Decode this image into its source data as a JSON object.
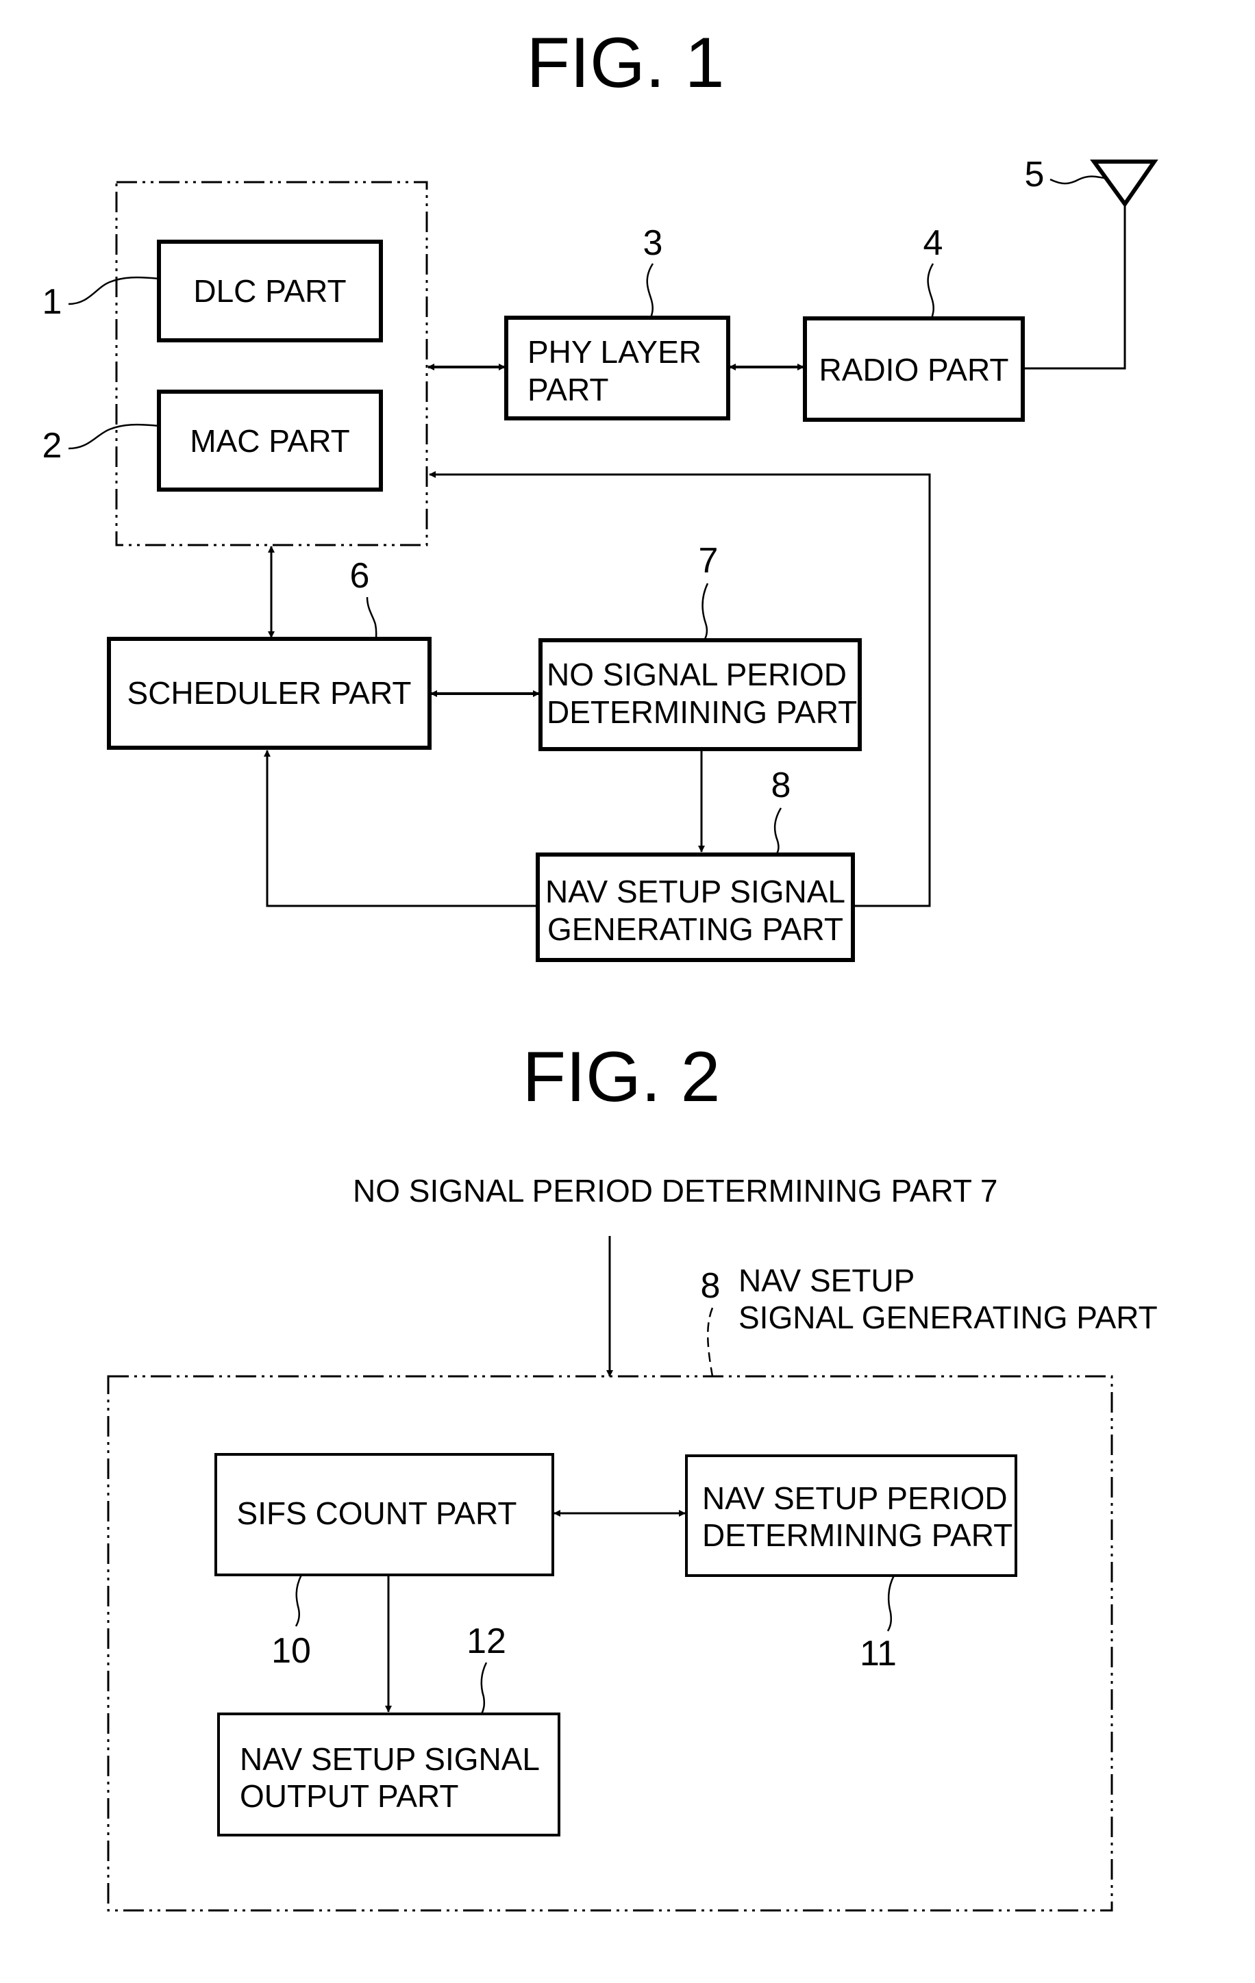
{
  "fig1": {
    "title": "FIG. 1",
    "blocks": {
      "dlc": {
        "label": "DLC PART",
        "ref": "1"
      },
      "mac": {
        "label": "MAC PART",
        "ref": "2"
      },
      "phy": {
        "label_line1": "PHY LAYER",
        "label_line2": "PART",
        "ref": "3"
      },
      "radio": {
        "label": "RADIO PART",
        "ref": "4"
      },
      "antenna": {
        "ref": "5"
      },
      "scheduler": {
        "label": "SCHEDULER PART",
        "ref": "6"
      },
      "no_signal": {
        "label_line1": "NO SIGNAL PERIOD",
        "label_line2": "DETERMINING PART",
        "ref": "7"
      },
      "nav_gen": {
        "label_line1": "NAV SETUP SIGNAL",
        "label_line2": "GENERATING PART",
        "ref": "8"
      }
    }
  },
  "fig2": {
    "title": "FIG. 2",
    "input_label": "NO SIGNAL PERIOD DETERMINING PART 7",
    "container": {
      "ref": "8",
      "label_line1": "NAV SETUP",
      "label_line2": "SIGNAL GENERATING PART"
    },
    "blocks": {
      "sifs": {
        "label": "SIFS COUNT PART",
        "ref": "10"
      },
      "nav_period": {
        "label_line1": "NAV SETUP PERIOD",
        "label_line2": "DETERMINING PART",
        "ref": "11"
      },
      "nav_output": {
        "label_line1": "NAV SETUP SIGNAL",
        "label_line2": "OUTPUT PART",
        "ref": "12"
      }
    }
  }
}
